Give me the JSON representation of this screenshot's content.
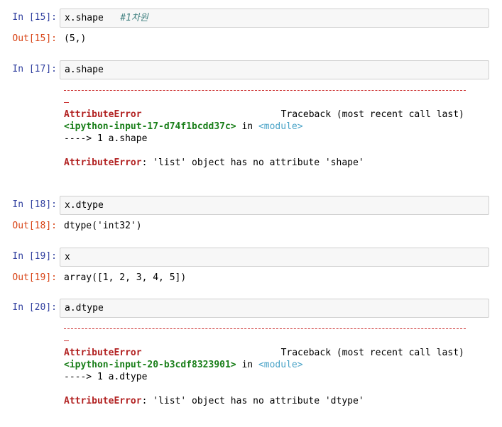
{
  "cells": [
    {
      "in_prompt": "In [15]:",
      "code": "x.shape",
      "code_comment": "#1차원",
      "out_prompt": "Out[15]:",
      "output": "(5,)"
    },
    {
      "in_prompt": "In [17]:",
      "code": "a.shape",
      "error": {
        "trailing_dash": "-",
        "name": "AttributeError",
        "traceback_label": "Traceback (most recent call last)",
        "input_ref": "<ipython-input-17-d74f1bcdd37c>",
        "in_word": " in ",
        "module": "<module>",
        "line": "----> 1 a.shape",
        "message": ": 'list' object has no attribute 'shape'"
      }
    },
    {
      "in_prompt": "In [18]:",
      "code": "x.dtype",
      "out_prompt": "Out[18]:",
      "output": "dtype('int32')"
    },
    {
      "in_prompt": "In [19]:",
      "code": "x",
      "out_prompt": "Out[19]:",
      "output": "array([1, 2, 3, 4, 5])"
    },
    {
      "in_prompt": "In [20]:",
      "code": "a.dtype",
      "error": {
        "trailing_dash": "-",
        "name": "AttributeError",
        "traceback_label": "Traceback (most recent call last)",
        "input_ref": "<ipython-input-20-b3cdf8323901>",
        "in_word": " in ",
        "module": "<module>",
        "line": "----> 1 a.dtype",
        "message": ": 'list' object has no attribute 'dtype'"
      }
    }
  ]
}
